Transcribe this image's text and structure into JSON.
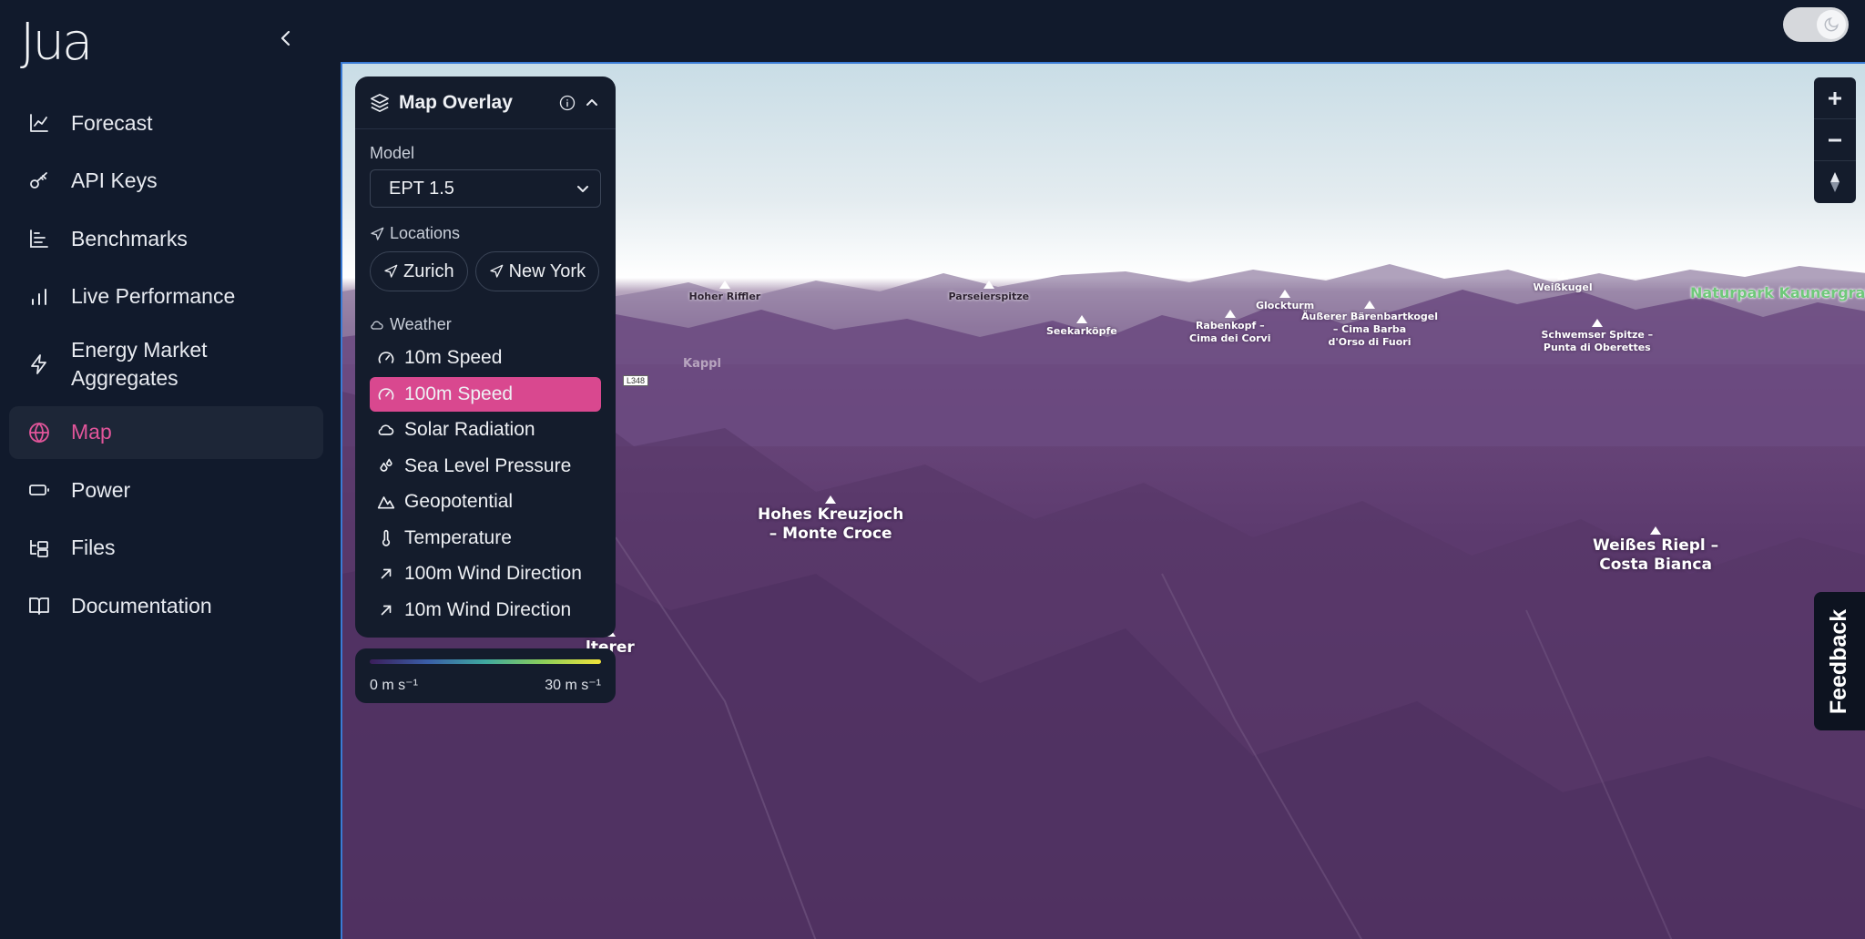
{
  "app": {
    "logo": "Jua"
  },
  "sidebar": {
    "items": [
      {
        "label": "Forecast",
        "icon": "line-chart-icon"
      },
      {
        "label": "API Keys",
        "icon": "key-icon"
      },
      {
        "label": "Benchmarks",
        "icon": "bar-chart-icon"
      },
      {
        "label": "Live Performance",
        "icon": "signal-bars-icon"
      },
      {
        "label": "Energy Market Aggregates",
        "icon": "lightning-icon"
      },
      {
        "label": "Map",
        "icon": "globe-icon",
        "active": true
      },
      {
        "label": "Power",
        "icon": "battery-icon"
      },
      {
        "label": "Files",
        "icon": "folder-tree-icon"
      },
      {
        "label": "Documentation",
        "icon": "book-icon"
      }
    ]
  },
  "overlay": {
    "title": "Map Overlay",
    "model_label": "Model",
    "model_value": "EPT 1.5",
    "locations_label": "Locations",
    "locations": [
      "Zurich",
      "New York"
    ],
    "weather_label": "Weather",
    "weather_items": [
      {
        "label": "10m Speed",
        "icon": "gauge-icon"
      },
      {
        "label": "100m Speed",
        "icon": "gauge-icon",
        "active": true
      },
      {
        "label": "Solar Radiation",
        "icon": "cloud-icon"
      },
      {
        "label": "Sea Level Pressure",
        "icon": "droplets-icon"
      },
      {
        "label": "Geopotential",
        "icon": "mountain-icon"
      },
      {
        "label": "Temperature",
        "icon": "thermometer-icon"
      },
      {
        "label": "100m Wind Direction",
        "icon": "arrow-up-right-icon"
      },
      {
        "label": "10m Wind Direction",
        "icon": "arrow-up-right-icon"
      }
    ]
  },
  "legend": {
    "min": "0 m s⁻¹",
    "max": "30 m s⁻¹"
  },
  "map": {
    "labels": {
      "hohes": "Hohes Kreuzjoch\n– Monte Croce",
      "weisses": "Weißes Riepl –\nCosta Bianca",
      "alterer": "lterer",
      "hoher_riffler": "Hoher Riffler",
      "parseierspitze": "Parseierspitze",
      "seekarkoepfe": "Seekarköpfe",
      "glockturm": "Glockturm",
      "rabenkopf": "Rabenkopf –\nCima dei Corvi",
      "baerenbartkogel": "Äußerer Bärenbartkogel\n– Cima Barba\nd'Orso di Fuori",
      "weisskugel": "Weißkugel",
      "schwemser": "Schwemser Spitze –\nPunta di Oberettes",
      "park": "Naturpark Kaunergrat",
      "kappl": "Kappl",
      "road": "L348"
    }
  },
  "feedback": {
    "label": "Feedback"
  },
  "colors": {
    "accent": "#d9488f",
    "sidebar_bg": "#111a2c",
    "panel_bg": "#141c2c"
  }
}
